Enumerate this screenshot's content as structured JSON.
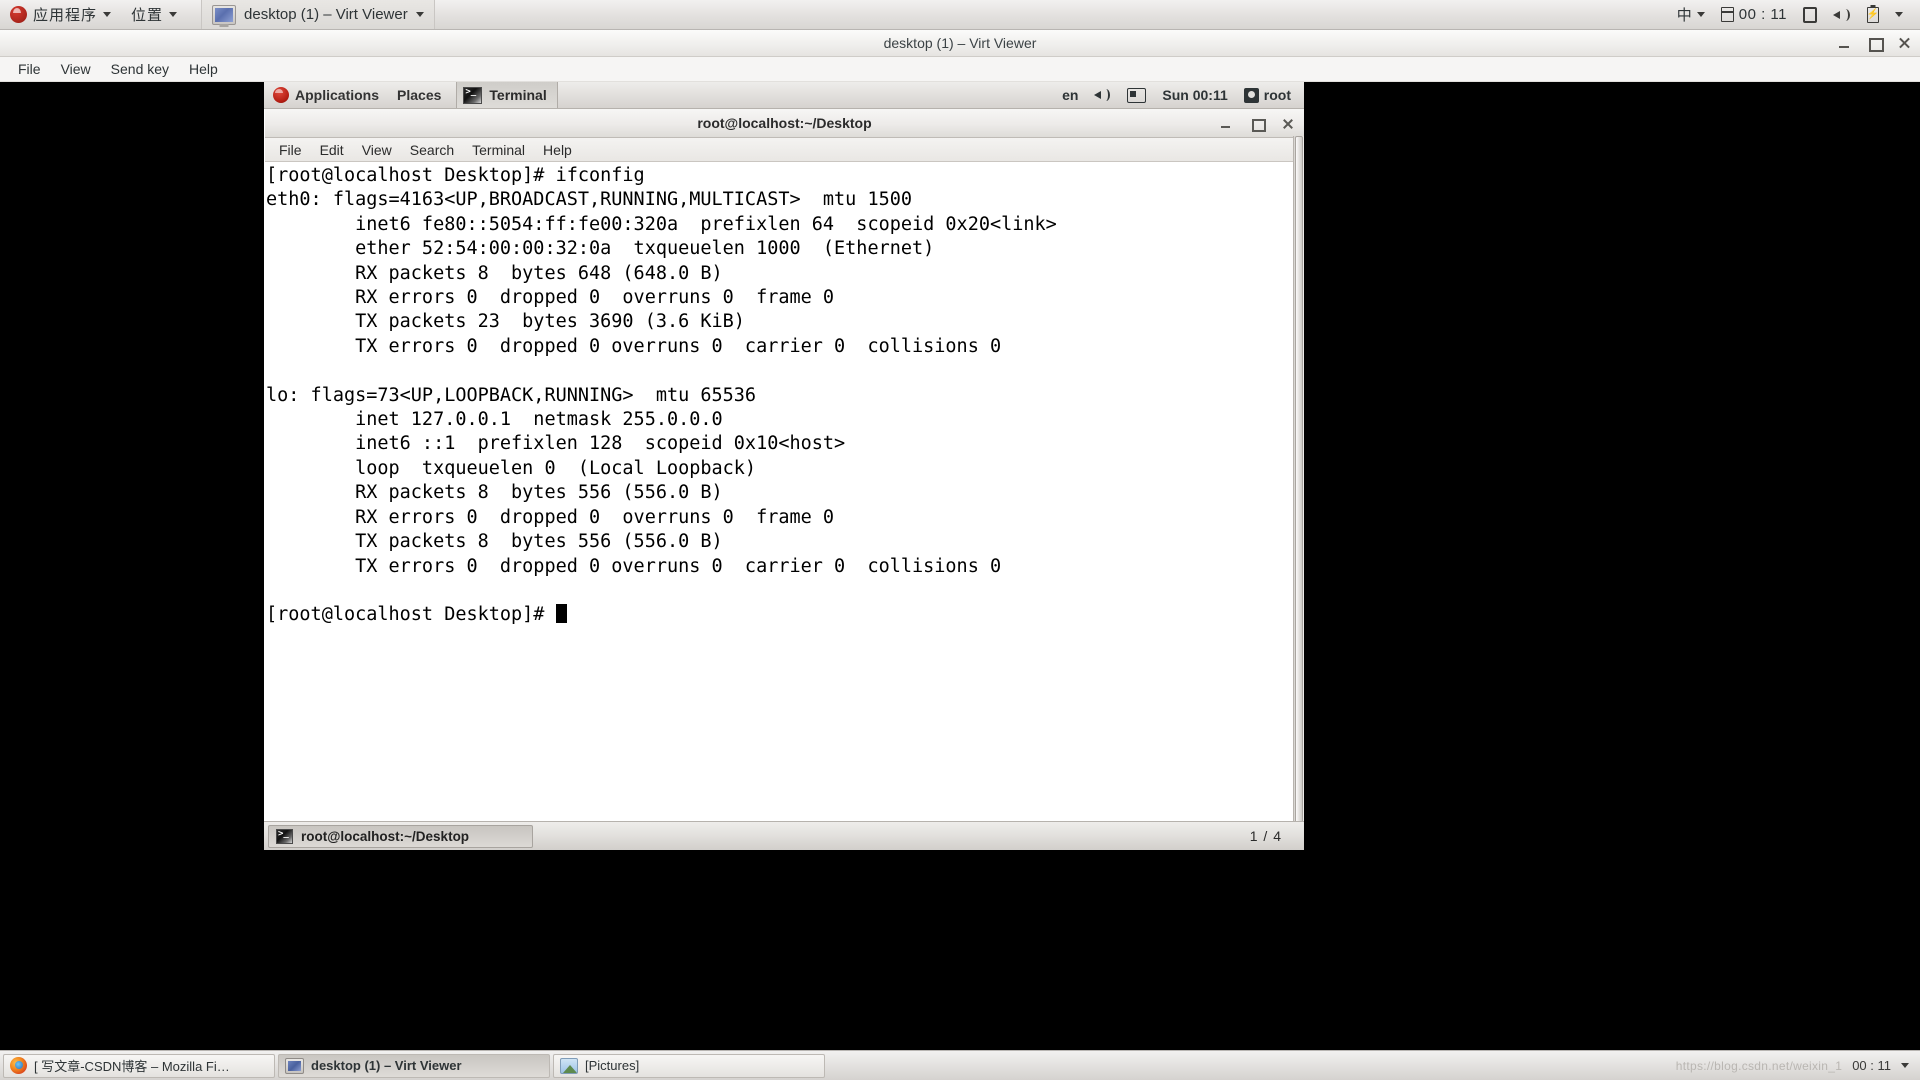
{
  "host_panel": {
    "applications_label": "应用程序",
    "places_label": "位置",
    "window_button_label": "desktop (1) – Virt Viewer",
    "input_method": "中",
    "clock": "00 : 11",
    "icons": [
      "fedora-icon",
      "monitor-icon",
      "calendar-icon",
      "display-icon",
      "volume-icon",
      "battery-icon",
      "chevron-down-icon"
    ]
  },
  "virt_viewer": {
    "title": "desktop (1) – Virt Viewer",
    "menu": [
      "File",
      "View",
      "Send key",
      "Help"
    ],
    "window_buttons": [
      "minimize",
      "maximize",
      "close"
    ]
  },
  "guest_top_panel": {
    "applications_label": "Applications",
    "places_label": "Places",
    "task_label": "Terminal",
    "keyboard_layout": "en",
    "clock": "Sun 00:11",
    "user": "root"
  },
  "terminal": {
    "title": "root@localhost:~/Desktop",
    "menu": [
      "File",
      "Edit",
      "View",
      "Search",
      "Terminal",
      "Help"
    ],
    "lines": [
      "[root@localhost Desktop]# ifconfig",
      "eth0: flags=4163<UP,BROADCAST,RUNNING,MULTICAST>  mtu 1500",
      "        inet6 fe80::5054:ff:fe00:320a  prefixlen 64  scopeid 0x20<link>",
      "        ether 52:54:00:00:32:0a  txqueuelen 1000  (Ethernet)",
      "        RX packets 8  bytes 648 (648.0 B)",
      "        RX errors 0  dropped 0  overruns 0  frame 0",
      "        TX packets 23  bytes 3690 (3.6 KiB)",
      "        TX errors 0  dropped 0 overruns 0  carrier 0  collisions 0",
      "",
      "lo: flags=73<UP,LOOPBACK,RUNNING>  mtu 65536",
      "        inet 127.0.0.1  netmask 255.0.0.0",
      "        inet6 ::1  prefixlen 128  scopeid 0x10<host>",
      "        loop  txqueuelen 0  (Local Loopback)",
      "        RX packets 8  bytes 556 (556.0 B)",
      "        RX errors 0  dropped 0  overruns 0  frame 0",
      "        TX packets 8  bytes 556 (556.0 B)",
      "        TX errors 0  dropped 0 overruns 0  carrier 0  collisions 0",
      ""
    ],
    "prompt": "[root@localhost Desktop]# "
  },
  "guest_bottom_panel": {
    "task_label": "root@localhost:~/Desktop",
    "workspace": "1 / 4"
  },
  "host_taskbar": {
    "items": [
      {
        "label": "[ 写文章-CSDN博客 – Mozilla Fi…",
        "icon": "firefox-icon",
        "active": false
      },
      {
        "label": "desktop (1) – Virt Viewer",
        "icon": "virt-viewer-icon",
        "active": true
      },
      {
        "label": "[Pictures]",
        "icon": "pictures-icon",
        "active": false
      }
    ],
    "watermark": "https://blog.csdn.net/weixin_1",
    "clock": "00 : 11"
  }
}
